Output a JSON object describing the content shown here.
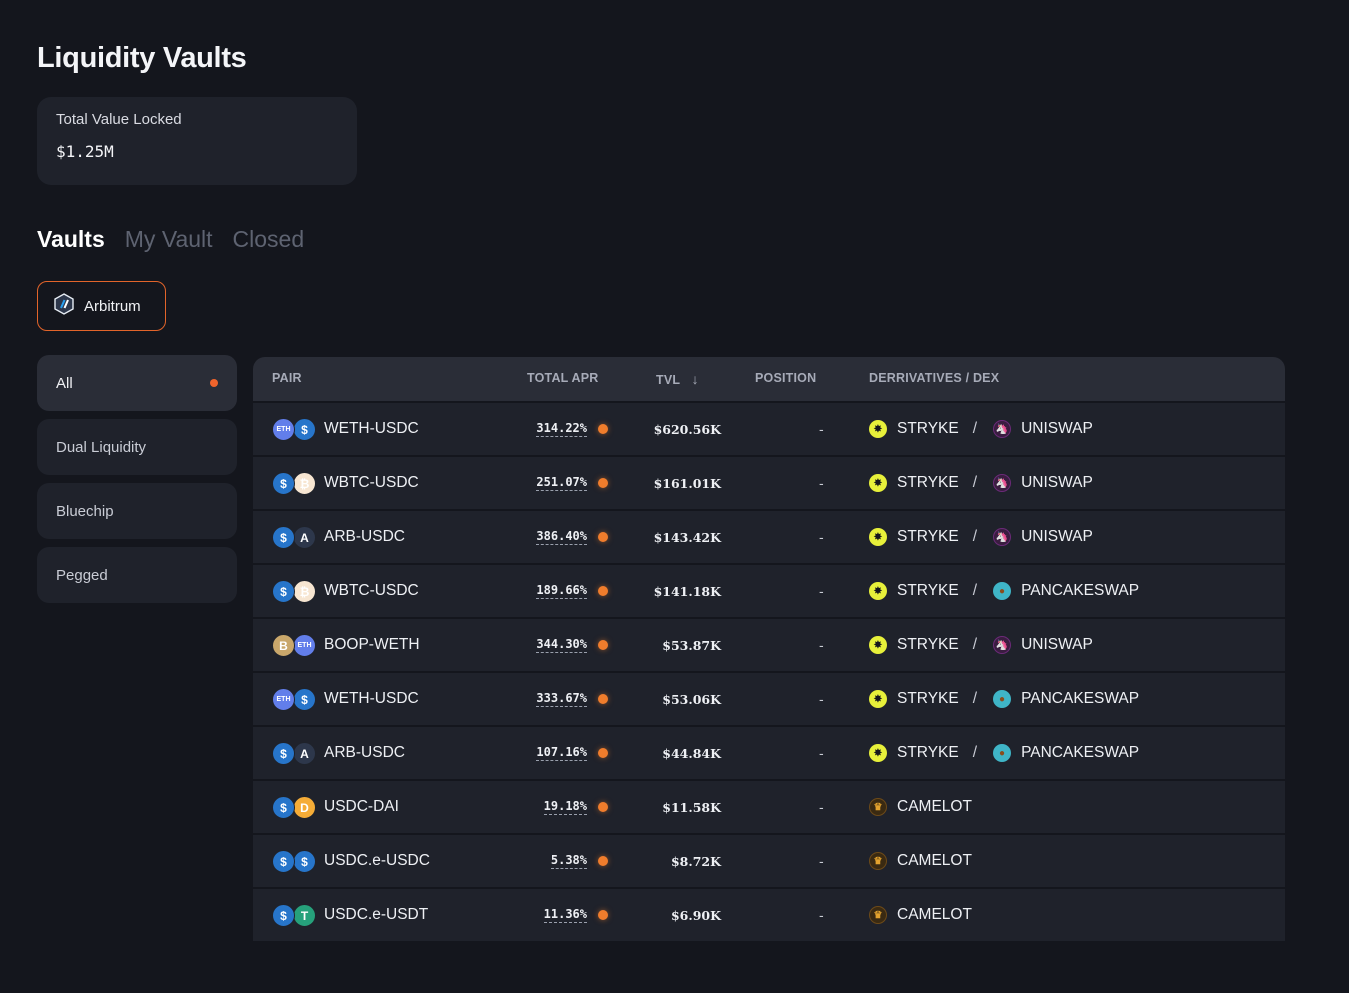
{
  "page": {
    "title": "Liquidity Vaults"
  },
  "tvl_card": {
    "label": "Total Value Locked",
    "value": "$1.25M"
  },
  "tabs": [
    {
      "label": "Vaults",
      "active": true
    },
    {
      "label": "My Vault",
      "active": false
    },
    {
      "label": "Closed",
      "active": false
    }
  ],
  "chain": {
    "label": "Arbitrum",
    "icon": "arbitrum-icon",
    "accent": "#e2642a"
  },
  "sidebar": [
    {
      "label": "All",
      "active": true
    },
    {
      "label": "Dual Liquidity",
      "active": false
    },
    {
      "label": "Bluechip",
      "active": false
    },
    {
      "label": "Pegged",
      "active": false
    }
  ],
  "table": {
    "headers": {
      "pair": "PAIR",
      "apr": "TOTAL APR",
      "tvl": "TVL",
      "tvl_sort": "↓",
      "position": "POSITION",
      "dex": "DERRIVATIVES / DEX"
    },
    "rows": [
      {
        "pair": "WETH-USDC",
        "coins": [
          "ETH",
          "$"
        ],
        "coin_colors": [
          "#627eea",
          "#2775ca"
        ],
        "apr": "314.22%",
        "tvl": "$620.56K",
        "position": "-",
        "deriv": "STRYKE",
        "sep": "/",
        "dex": "UNISWAP"
      },
      {
        "pair": "WBTC-USDC",
        "coins": [
          "$",
          "₿"
        ],
        "coin_colors": [
          "#2775ca",
          "#f7e6d2"
        ],
        "apr": "251.07%",
        "tvl": "$161.01K",
        "position": "-",
        "deriv": "STRYKE",
        "sep": "/",
        "dex": "UNISWAP"
      },
      {
        "pair": "ARB-USDC",
        "coins": [
          "$",
          "A"
        ],
        "coin_colors": [
          "#2775ca",
          "#2d374b"
        ],
        "apr": "386.40%",
        "tvl": "$143.42K",
        "position": "-",
        "deriv": "STRYKE",
        "sep": "/",
        "dex": "UNISWAP"
      },
      {
        "pair": "WBTC-USDC",
        "coins": [
          "$",
          "₿"
        ],
        "coin_colors": [
          "#2775ca",
          "#f7e6d2"
        ],
        "apr": "189.66%",
        "tvl": "$141.18K",
        "position": "-",
        "deriv": "STRYKE",
        "sep": "/",
        "dex": "PANCAKESWAP"
      },
      {
        "pair": "BOOP-WETH",
        "coins": [
          "B",
          "ETH"
        ],
        "coin_colors": [
          "#c9a76b",
          "#627eea"
        ],
        "apr": "344.30%",
        "tvl": "$53.87K",
        "position": "-",
        "deriv": "STRYKE",
        "sep": "/",
        "dex": "UNISWAP"
      },
      {
        "pair": "WETH-USDC",
        "coins": [
          "ETH",
          "$"
        ],
        "coin_colors": [
          "#627eea",
          "#2775ca"
        ],
        "apr": "333.67%",
        "tvl": "$53.06K",
        "position": "-",
        "deriv": "STRYKE",
        "sep": "/",
        "dex": "PANCAKESWAP"
      },
      {
        "pair": "ARB-USDC",
        "coins": [
          "$",
          "A"
        ],
        "coin_colors": [
          "#2775ca",
          "#2d374b"
        ],
        "apr": "107.16%",
        "tvl": "$44.84K",
        "position": "-",
        "deriv": "STRYKE",
        "sep": "/",
        "dex": "PANCAKESWAP"
      },
      {
        "pair": "USDC-DAI",
        "coins": [
          "$",
          "D"
        ],
        "coin_colors": [
          "#2775ca",
          "#f5ac37"
        ],
        "apr": "19.18%",
        "tvl": "$11.58K",
        "position": "-",
        "deriv": "",
        "sep": "",
        "dex": "CAMELOT"
      },
      {
        "pair": "USDC.e-USDC",
        "coins": [
          "$",
          "$"
        ],
        "coin_colors": [
          "#2775ca",
          "#2775ca"
        ],
        "apr": "5.38%",
        "tvl": "$8.72K",
        "position": "-",
        "deriv": "",
        "sep": "",
        "dex": "CAMELOT"
      },
      {
        "pair": "USDC.e-USDT",
        "coins": [
          "$",
          "T"
        ],
        "coin_colors": [
          "#2775ca",
          "#26a17b"
        ],
        "apr": "11.36%",
        "tvl": "$6.90K",
        "position": "-",
        "deriv": "",
        "sep": "",
        "dex": "CAMELOT"
      }
    ]
  }
}
